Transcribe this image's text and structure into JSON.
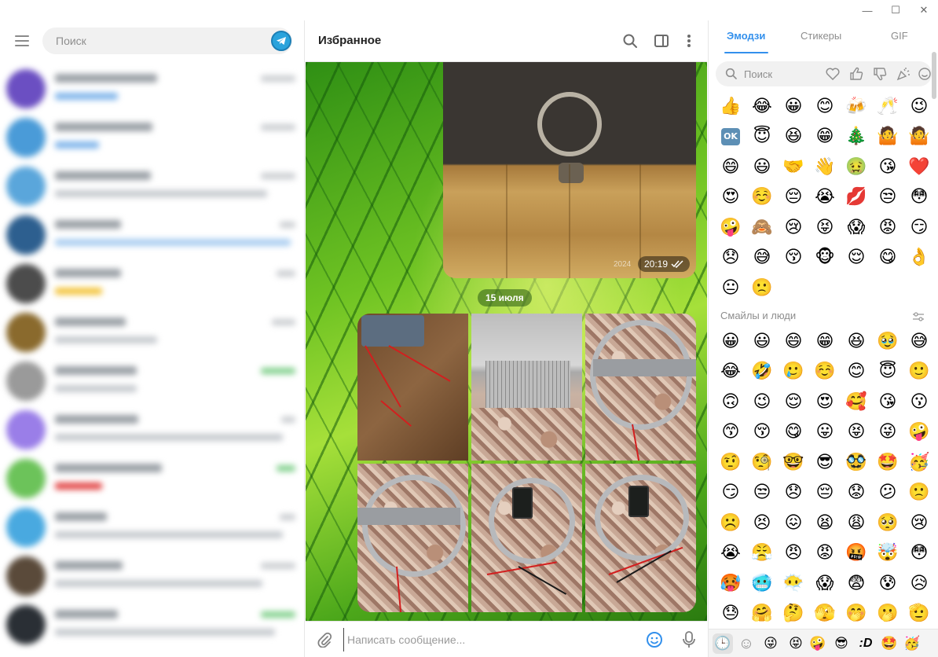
{
  "window": {
    "minimize_glyph": "—",
    "maximize_glyph": "☐",
    "close_glyph": "✕"
  },
  "sidebar": {
    "search_placeholder": "Поиск"
  },
  "chat": {
    "title": "Избранное",
    "photo_time": "20:19",
    "photo_watermark": "2024",
    "date_separator": "15 июля",
    "composer_placeholder": "Написать сообщение..."
  },
  "emoji_panel": {
    "tabs": [
      "Эмодзи",
      "Стикеры",
      "GIF"
    ],
    "active_tab": "Эмодзи",
    "search_placeholder": "Поиск",
    "recent_emojis": [
      "👍",
      "😂",
      "😀",
      "😊",
      "🍻",
      "🥂",
      "😉",
      "OK",
      "😇",
      "😆",
      "😁",
      "🎄",
      "🤷",
      "🤷",
      "😄",
      "😃",
      "🤝",
      "👋",
      "🤢",
      "😘",
      "❤️",
      "😍",
      "☺️",
      "😔",
      "😭",
      "💋",
      "😒",
      "😳",
      "🤪",
      "🙈",
      "😢",
      "😝",
      "😱",
      "😡",
      "😏",
      "😞",
      "😅",
      "😚",
      "🐵",
      "😌",
      "😋",
      "👌",
      "😐",
      "🙁"
    ],
    "section_title": "Смайлы и люди",
    "people_emojis": [
      "😀",
      "😃",
      "😄",
      "😁",
      "😆",
      "🥹",
      "😅",
      "😂",
      "🤣",
      "🥲",
      "☺️",
      "😊",
      "😇",
      "🙂",
      "🙃",
      "😉",
      "😌",
      "😍",
      "🥰",
      "😘",
      "😗",
      "😙",
      "😚",
      "😋",
      "😛",
      "😝",
      "😜",
      "🤪",
      "🤨",
      "🧐",
      "🤓",
      "😎",
      "🥸",
      "🤩",
      "🥳",
      "😏",
      "😒",
      "😞",
      "😔",
      "😟",
      "😕",
      "🙁",
      "☹️",
      "😣",
      "😖",
      "😫",
      "😩",
      "🥺",
      "😢",
      "😭",
      "😤",
      "😠",
      "😡",
      "🤬",
      "🤯",
      "😳",
      "🥵",
      "🥶",
      "😶‍🌫️",
      "😱",
      "😨",
      "😰",
      "😥",
      "😓",
      "🤗",
      "🤔",
      "🫣",
      "🤭",
      "🫢",
      "🫡"
    ],
    "footer_items": [
      "🕒",
      "☺",
      "😜",
      "😝",
      "🤪",
      "😎",
      ":D",
      "🤩",
      "🥳"
    ]
  },
  "colors": {
    "accent": "#3390ec",
    "telegram_logo": "#2aa3dc"
  }
}
